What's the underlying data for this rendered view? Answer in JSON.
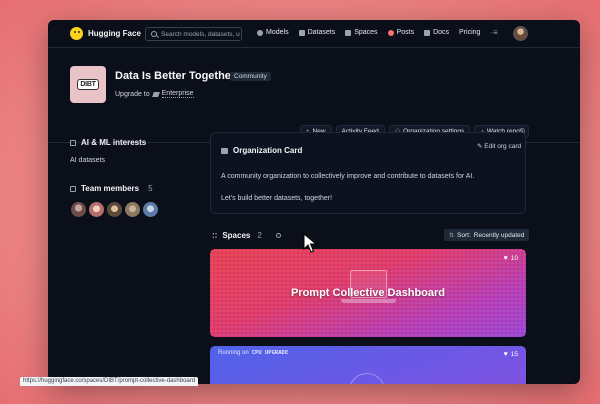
{
  "nav": {
    "logo": "Hugging Face",
    "search_placeholder": "Search models, datasets, u",
    "items": [
      "Models",
      "Datasets",
      "Spaces",
      "Posts",
      "Docs",
      "Pricing"
    ],
    "menu_glyph": "·≡"
  },
  "org": {
    "logo_text": "DIBT",
    "name": "Data Is Better Together",
    "badge": "Community",
    "upgrade_prefix": "Upgrade to",
    "upgrade_plan": "Enterprise"
  },
  "actions": [
    "New",
    "Activity Feed",
    "Organization settings",
    "Watch repos"
  ],
  "left": {
    "interests_title": "AI & ML interests",
    "interests": "AI datasets",
    "team_title": "Team members",
    "team_count": "5"
  },
  "card": {
    "title": "Organization Card",
    "edit": "Edit org card",
    "desc": "A community organization to collectively improve and contribute to datasets for AI.",
    "desc2": "Let's build better datasets, together!"
  },
  "spaces": {
    "title": "Spaces",
    "count": "2",
    "sort_label": "Sort:",
    "sort_value": "Recently updated",
    "items": [
      {
        "title": "Prompt Collective Dashboard",
        "likes": "10"
      },
      {
        "running": "Running on",
        "hardware": "CPU UPGRADE",
        "likes": "15"
      }
    ]
  },
  "status_url": "https://huggingface.co/spaces/DIBT/prompt-collective-dashboard",
  "colors": {
    "bg": "#0b0f19",
    "accent_red": "#e53f52",
    "accent_purple": "#9b45d1",
    "accent_blue": "#4f63e8"
  }
}
